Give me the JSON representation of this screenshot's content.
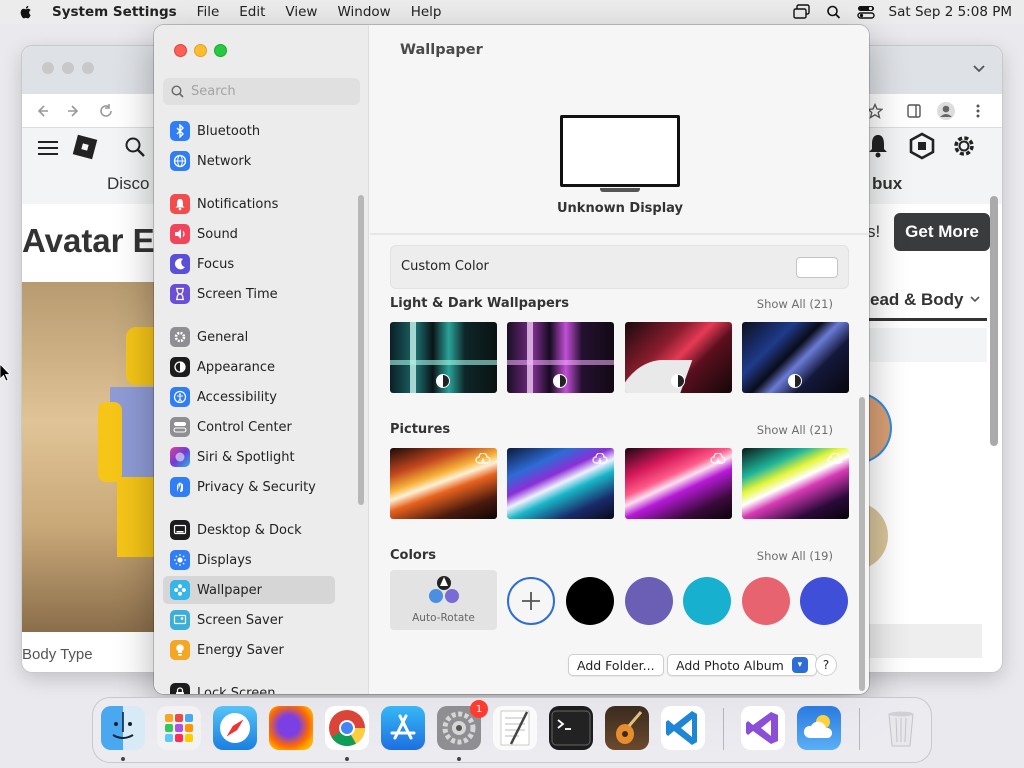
{
  "menubar": {
    "app": "System Settings",
    "items": [
      "File",
      "Edit",
      "View",
      "Window",
      "Help"
    ],
    "clock": "Sat Sep 2  5:08 PM"
  },
  "browser": {
    "nav_label": "Disco",
    "nav_label_right": "bux",
    "page_title": "Avatar E",
    "get_more": "Get More",
    "partial_text": "s!",
    "head_body": "ead & Body",
    "body_type": "Body Type"
  },
  "sidebar": {
    "search_placeholder": "Search",
    "items": [
      {
        "label": "Bluetooth",
        "icon": "bluetooth-icon",
        "color": "#2f7ef6"
      },
      {
        "label": "Network",
        "icon": "network-icon",
        "color": "#2f7ef6"
      },
      {
        "label": "Notifications",
        "icon": "notifications-icon",
        "color": "#f24c4c"
      },
      {
        "label": "Sound",
        "icon": "sound-icon",
        "color": "#f2455b"
      },
      {
        "label": "Focus",
        "icon": "focus-icon",
        "color": "#5a4fd6"
      },
      {
        "label": "Screen Time",
        "icon": "screen-time-icon",
        "color": "#6a4fd6"
      },
      {
        "label": "General",
        "icon": "general-icon",
        "color": "#8e8e93"
      },
      {
        "label": "Appearance",
        "icon": "appearance-icon",
        "color": "#1c1c1e"
      },
      {
        "label": "Accessibility",
        "icon": "accessibility-icon",
        "color": "#2f7ef6"
      },
      {
        "label": "Control Center",
        "icon": "control-center-icon",
        "color": "#8e8e93"
      },
      {
        "label": "Siri & Spotlight",
        "icon": "siri-icon",
        "color": "#8a3ec9"
      },
      {
        "label": "Privacy & Security",
        "icon": "privacy-icon",
        "color": "#2f7ef6"
      },
      {
        "label": "Desktop & Dock",
        "icon": "desktop-dock-icon",
        "color": "#1c1c1e"
      },
      {
        "label": "Displays",
        "icon": "displays-icon",
        "color": "#2f7ef6"
      },
      {
        "label": "Wallpaper",
        "icon": "wallpaper-icon",
        "color": "#36b5e8"
      },
      {
        "label": "Screen Saver",
        "icon": "screen-saver-icon",
        "color": "#3ab0d9"
      },
      {
        "label": "Energy Saver",
        "icon": "energy-saver-icon",
        "color": "#f5a623"
      },
      {
        "label": "Lock Screen",
        "icon": "lock-screen-icon",
        "color": "#1c1c1e"
      }
    ],
    "selected": "Wallpaper"
  },
  "main": {
    "title": "Wallpaper",
    "display_name": "Unknown Display",
    "custom_color_label": "Custom Color",
    "custom_color_value": "#ffffff",
    "sections": {
      "light_dark": {
        "title": "Light & Dark Wallpapers",
        "show_all": "Show All (21)"
      },
      "pictures": {
        "title": "Pictures",
        "show_all": "Show All (21)"
      },
      "colors": {
        "title": "Colors",
        "show_all": "Show All (19)"
      }
    },
    "auto_rotate": "Auto-Rotate",
    "color_swatches": [
      "#000000",
      "#6a5fb5",
      "#18b0cf",
      "#e7636f",
      "#3f4fd8"
    ],
    "buttons": {
      "add_folder": "Add Folder...",
      "add_photo_album": "Add Photo Album",
      "help": "?"
    }
  },
  "dock": {
    "apps": [
      {
        "name": "Finder",
        "icon": "finder-icon"
      },
      {
        "name": "Launchpad",
        "icon": "launchpad-icon"
      },
      {
        "name": "Safari",
        "icon": "safari-icon"
      },
      {
        "name": "Firefox",
        "icon": "firefox-icon"
      },
      {
        "name": "Chrome",
        "icon": "chrome-icon"
      },
      {
        "name": "App Store",
        "icon": "app-store-icon"
      },
      {
        "name": "System Settings",
        "icon": "system-settings-icon"
      },
      {
        "name": "TextEdit",
        "icon": "textedit-icon"
      },
      {
        "name": "Terminal",
        "icon": "terminal-icon"
      },
      {
        "name": "GarageBand",
        "icon": "garageband-icon"
      },
      {
        "name": "Visual Studio Code",
        "icon": "vscode-icon"
      },
      {
        "name": "Visual Studio",
        "icon": "visual-studio-icon"
      },
      {
        "name": "Weather",
        "icon": "weather-icon"
      },
      {
        "name": "Trash",
        "icon": "trash-icon"
      }
    ],
    "settings_badge": "1"
  }
}
